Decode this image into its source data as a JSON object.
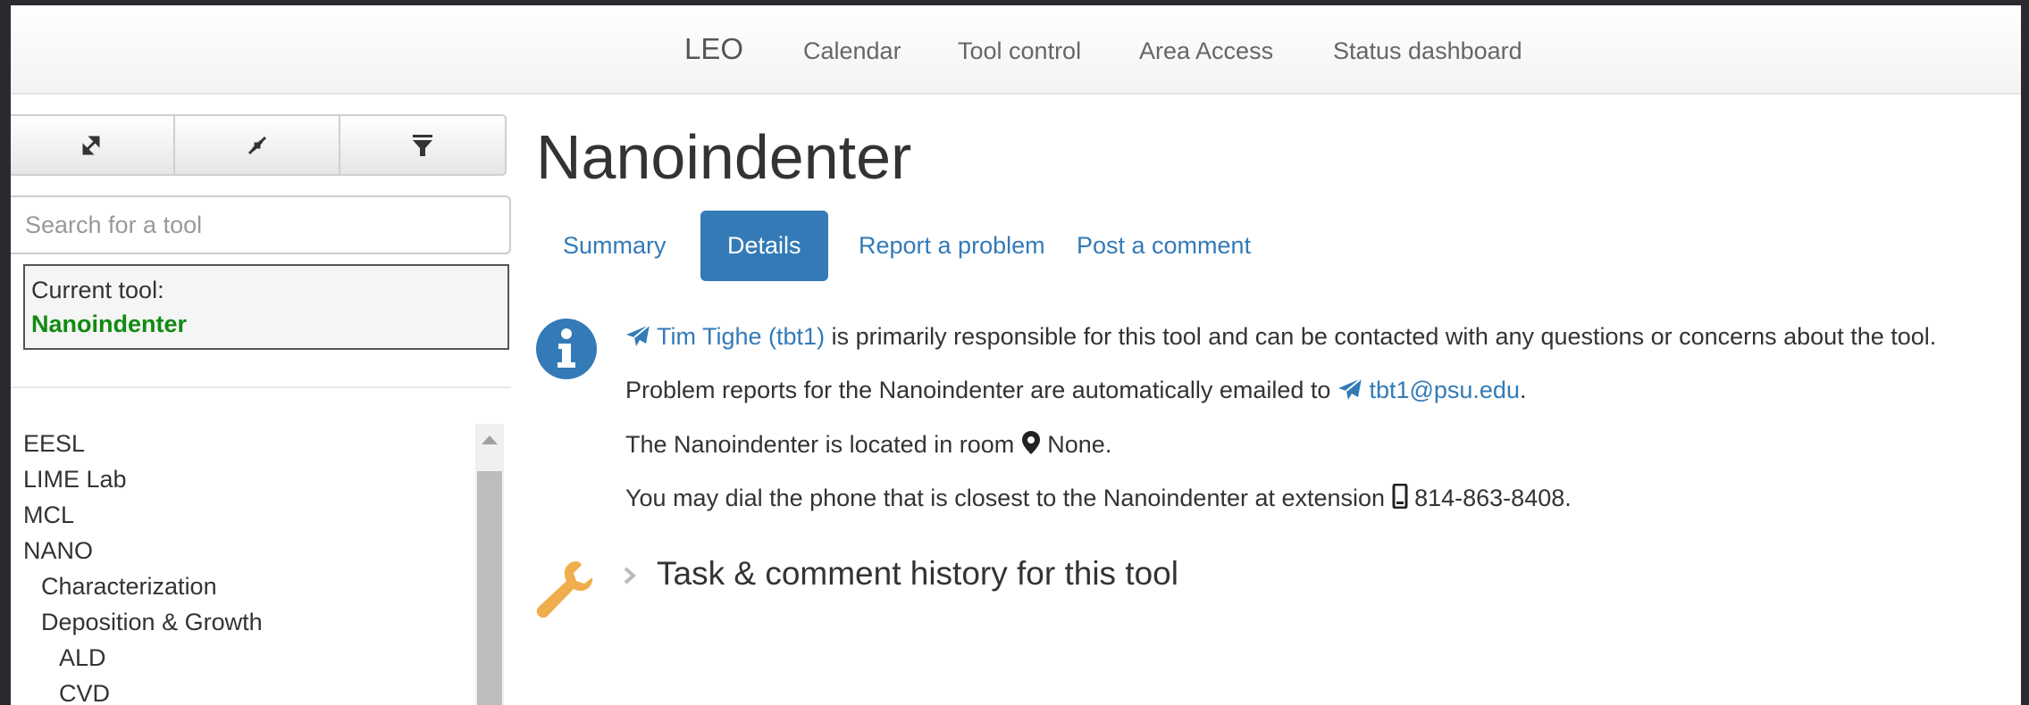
{
  "navbar": {
    "brand": "LEO",
    "links": [
      "Calendar",
      "Tool control",
      "Area Access",
      "Status dashboard"
    ]
  },
  "sidebar": {
    "buttons": [
      "expand-all-icon",
      "collapse-all-icon",
      "filter-icon"
    ],
    "search_placeholder": "Search for a tool",
    "current_tool_label": "Current tool:",
    "current_tool_name": "Nanoindenter",
    "tree": [
      "EESL",
      "LIME Lab",
      "MCL",
      "NANO",
      "Characterization",
      "Deposition & Growth",
      "ALD",
      "CVD"
    ]
  },
  "main": {
    "title": "Nanoindenter",
    "tabs": [
      "Summary",
      "Details",
      "Report a problem",
      "Post a comment"
    ],
    "active_tab": "Details",
    "responsible": {
      "name": "Tim Tighe (tbt1)",
      "text": " is primarily responsible for this tool and can be contacted with any questions or concerns about the tool."
    },
    "reports": {
      "text": "Problem reports for the Nanoindenter are automatically emailed to ",
      "email": "tbt1@psu.edu",
      "suffix": "."
    },
    "location": {
      "text": "The Nanoindenter is located in room ",
      "room": "None."
    },
    "phone": {
      "text": "You may dial the phone that is closest to the Nanoindenter at extension ",
      "number": "814-863-8408."
    },
    "task_history": "Task & comment history for this tool"
  },
  "colors": {
    "link": "#337ab7",
    "current_tool": "#118a11",
    "wrench": "#f0ad4e",
    "info": "#337ab7"
  }
}
